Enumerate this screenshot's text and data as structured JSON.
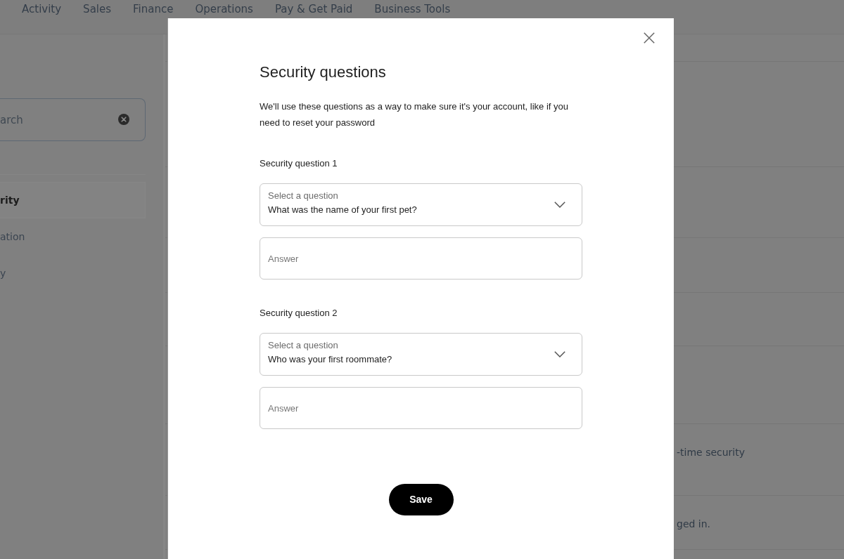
{
  "nav": {
    "items": [
      "Activity",
      "Sales",
      "Finance",
      "Operations",
      "Pay & Get Paid",
      "Business Tools"
    ]
  },
  "sidebar": {
    "search": {
      "placeholder": "arch"
    },
    "items": [
      {
        "label": "rity",
        "selected": true
      },
      {
        "label": "ation",
        "selected": false
      },
      {
        "label": "y",
        "selected": false
      }
    ]
  },
  "main": {
    "rows": [
      "-time security",
      "ged in."
    ]
  },
  "dialog": {
    "title": "Security questions",
    "description": "We'll use these questions as a way to make sure it's your account, like if you need to reset your password",
    "questions": [
      {
        "label": "Security question 1",
        "select": {
          "label": "Select a question",
          "value": "What was the name of your first pet?"
        },
        "answer": {
          "placeholder": "Answer"
        }
      },
      {
        "label": "Security question 2",
        "select": {
          "label": "Select a question",
          "value": "Who was your first roommate?"
        },
        "answer": {
          "placeholder": "Answer"
        }
      }
    ],
    "save_button": "Save"
  }
}
